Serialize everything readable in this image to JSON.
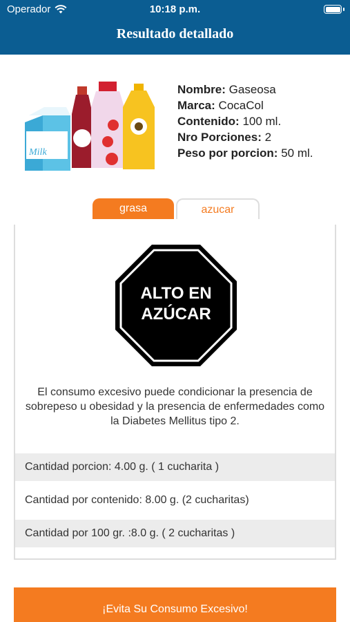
{
  "status_bar": {
    "carrier": "Operador",
    "time": "10:18 p.m."
  },
  "header": {
    "title": "Resultado detallado"
  },
  "product": {
    "image_text": "Milk",
    "fields": [
      {
        "label": "Nombre:",
        "value": "Gaseosa"
      },
      {
        "label": "Marca:",
        "value": "CocaCol"
      },
      {
        "label": "Contenido:",
        "value": "100 ml."
      },
      {
        "label": "Nro Porciones:",
        "value": "2"
      },
      {
        "label": "Peso por porcion:",
        "value": "50 ml."
      }
    ]
  },
  "tabs": [
    {
      "label": "grasa",
      "active": false
    },
    {
      "label": "azucar",
      "active": true
    }
  ],
  "warning": {
    "seal_line1": "ALTO EN",
    "seal_line2": "AZÚCAR",
    "description": "El consumo excesivo puede condicionar la presencia de sobrepeso u obesidad y la presencia de enfermedades como la Diabetes Mellitus tipo 2."
  },
  "amounts": [
    "Cantidad porcion: 4.00 g. ( 1 cucharita )",
    "Cantidad por contenido: 8.00 g. (2 cucharitas)",
    "Cantidad por 100 gr. :8.0 g. ( 2 cucharitas )"
  ],
  "cta": {
    "label": "¡Evita Su Consumo Excesivo!"
  },
  "colors": {
    "header_bg": "#0b5d92",
    "accent": "#f47b20",
    "seal": "#000000"
  }
}
